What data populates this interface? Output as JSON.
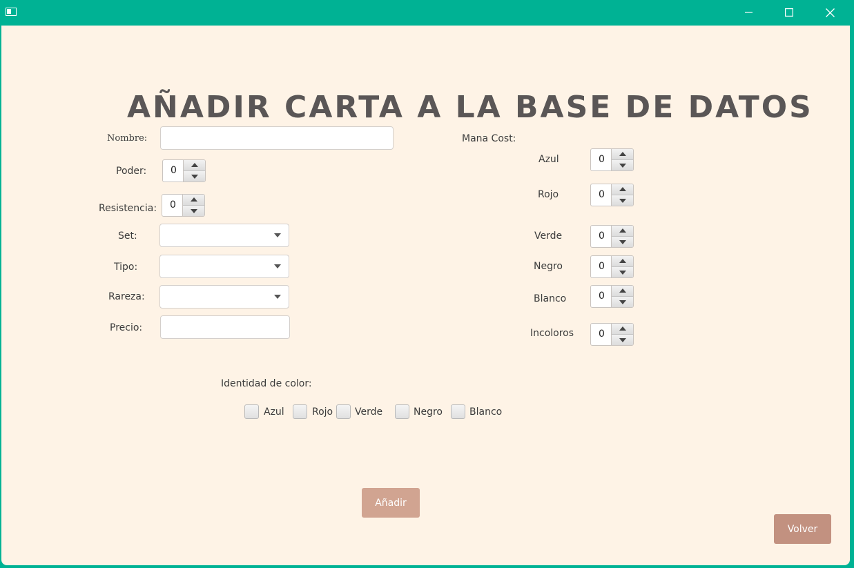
{
  "window": {
    "controls": {
      "minimize": "minimize-icon",
      "maximize": "maximize-icon",
      "close": "close-icon"
    }
  },
  "heading": "AÑADIR CARTA A LA BASE DE DATOS",
  "form": {
    "nombre": {
      "label": "Nombre:",
      "value": ""
    },
    "poder": {
      "label": "Poder:",
      "value": "0"
    },
    "resistencia": {
      "label": "Resistencia:",
      "value": "0"
    },
    "set": {
      "label": "Set:",
      "value": ""
    },
    "tipo": {
      "label": "Tipo:",
      "value": ""
    },
    "rareza": {
      "label": "Rareza:",
      "value": ""
    },
    "precio": {
      "label": "Precio:",
      "value": ""
    }
  },
  "mana": {
    "label": "Mana Cost:",
    "azul": {
      "label": "Azul",
      "value": "0"
    },
    "rojo": {
      "label": "Rojo",
      "value": "0"
    },
    "verde": {
      "label": "Verde",
      "value": "0"
    },
    "negro": {
      "label": "Negro",
      "value": "0"
    },
    "blanco": {
      "label": "Blanco",
      "value": "0"
    },
    "incoloros": {
      "label": "Incoloros",
      "value": "0"
    }
  },
  "identity": {
    "label": "Identidad de color:",
    "colors": [
      "Azul",
      "Rojo",
      "Verde",
      "Negro",
      "Blanco"
    ]
  },
  "buttons": {
    "add": "Añadir",
    "back": "Volver"
  },
  "colors": {
    "titlebar": "#00b294",
    "background": "#fef3e6",
    "add_button": "#d1a491",
    "back_button": "#c29180",
    "heading": "#5a5656"
  }
}
